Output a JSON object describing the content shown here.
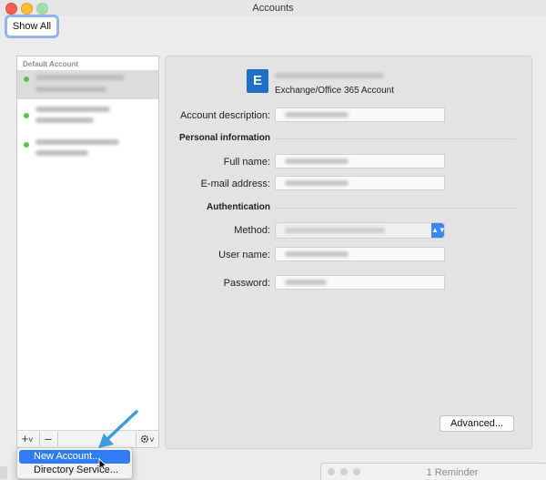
{
  "window": {
    "title": "Accounts",
    "show_all_label": "Show All"
  },
  "sidebar": {
    "header": "Default Account",
    "toolbar": {
      "add_label": "+",
      "add_chevron": "˅",
      "remove_label": "–",
      "gear_chevron": "˅"
    }
  },
  "add_menu": {
    "items": [
      {
        "label": "New Account..."
      },
      {
        "label": "Directory Service..."
      }
    ]
  },
  "detail": {
    "account_type": "Exchange/Office 365 Account",
    "icon_letter": "E",
    "labels": {
      "account_description": "Account description:",
      "personal_information": "Personal information",
      "full_name": "Full name:",
      "email_address": "E-mail address:",
      "authentication": "Authentication",
      "method": "Method:",
      "user_name": "User name:",
      "password": "Password:"
    },
    "advanced_label": "Advanced..."
  },
  "reminder_window": {
    "title": "1 Reminder"
  },
  "colors": {
    "accent": "#2f7cf6",
    "status_dot": "#5cc14d",
    "exchange_icon": "#1f6fc5",
    "annotation_arrow": "#3d9bd6"
  }
}
